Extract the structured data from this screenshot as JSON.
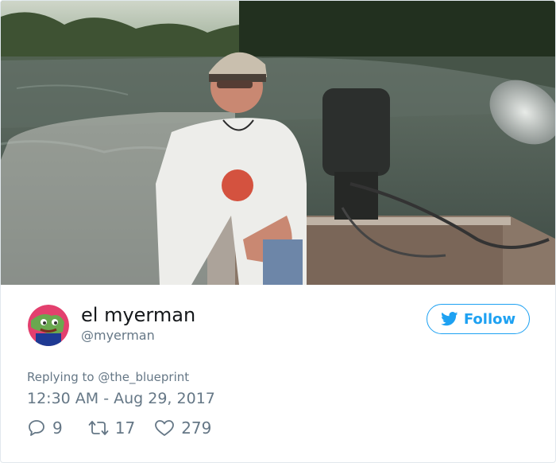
{
  "tweet": {
    "display_name": "el myerman",
    "handle": "@myerman",
    "follow_label": "Follow",
    "replying_prefix": "Replying to",
    "replying_to": "@the_blueprint",
    "timestamp": "12:30 AM - Aug 29, 2017",
    "reply_count": "9",
    "retweet_count": "17",
    "like_count": "279",
    "colors": {
      "accent": "#1da1f2",
      "secondary_text": "#657786",
      "border": "#e1e8ed"
    },
    "icons": {
      "follow": "twitter-bird-icon",
      "reply": "reply-icon",
      "retweet": "retweet-icon",
      "like": "heart-icon"
    }
  }
}
